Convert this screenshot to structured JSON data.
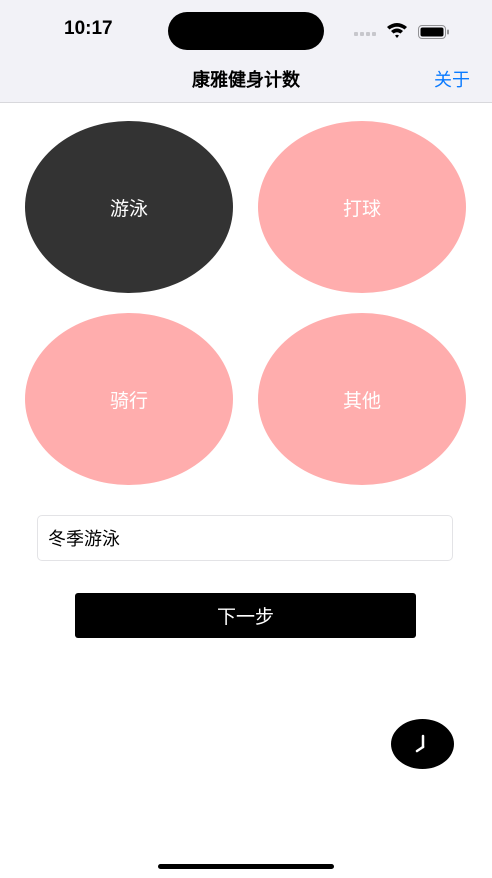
{
  "status_bar": {
    "time": "10:17",
    "icons": [
      "signal-icon",
      "wifi-icon",
      "battery-icon"
    ]
  },
  "nav": {
    "title": "康雅健身计数",
    "about_label": "关于",
    "about_color": "#0a7aff"
  },
  "options": [
    {
      "label": "游泳",
      "selected": true,
      "color": "#333333"
    },
    {
      "label": "打球",
      "selected": false,
      "color": "#ffadad"
    },
    {
      "label": "骑行",
      "selected": false,
      "color": "#ffadad"
    },
    {
      "label": "其他",
      "selected": false,
      "color": "#ffadad"
    }
  ],
  "name_input": {
    "value": "冬季游泳"
  },
  "next_button": {
    "label": "下一步"
  },
  "fab": {
    "icon": "clock-icon"
  }
}
